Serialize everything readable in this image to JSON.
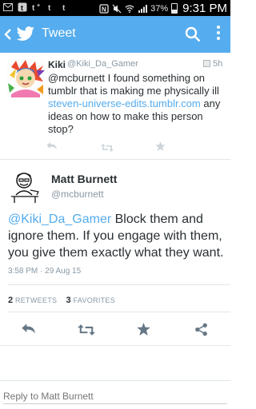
{
  "status_bar": {
    "battery": "37%",
    "time": "9:31 PM",
    "notification_icons": [
      "mail-icon",
      "tumblr-icon",
      "tumblr-plus-icon",
      "tumblr-icon",
      "tumblr-icon"
    ]
  },
  "app_bar": {
    "title": "Tweet",
    "color": "#55acee"
  },
  "reply_tweet": {
    "name": "Kiki",
    "handle": "@Kiki_Da_Gamer",
    "time": "5h",
    "text_before": "@mcburnett I found something on tumblr that is making me physically ill ",
    "link": "steven-universe-edits.tumblr.com",
    "text_after": " any ideas on how to make this person stop?"
  },
  "main_tweet": {
    "name": "Matt Burnett",
    "handle": "@mcburnett",
    "mention": "@Kiki_Da_Gamer",
    "text": " Block them and ignore them.  If you engage with them, you give them exactly what they want.",
    "timestamp": "3:58 PM · 29 Aug 15",
    "retweets_count": "2",
    "retweets_label": "RETWEETS",
    "favorites_count": "3",
    "favorites_label": "FAVORITES"
  },
  "reply_box": {
    "placeholder": "Reply to Matt Burnett"
  },
  "colors": {
    "accent": "#55acee",
    "text": "#292f33",
    "muted": "#8899a6"
  }
}
